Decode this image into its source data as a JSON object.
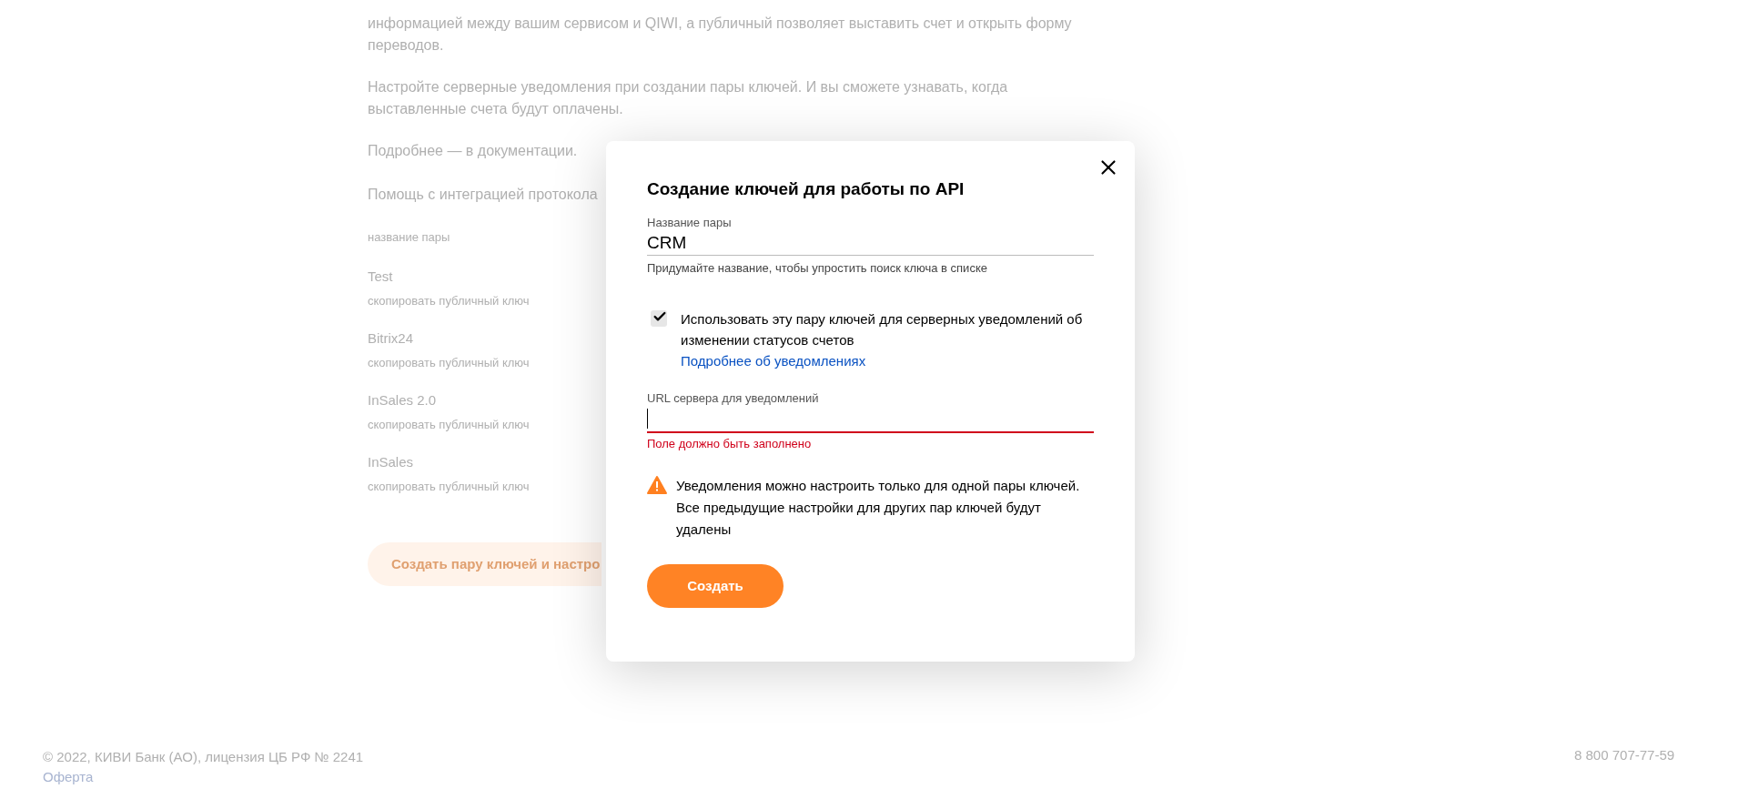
{
  "page": {
    "paragraphs": [
      "информацией между вашим сервисом и QIWI, а публичный позволяет выставить счет и открыть форму переводов.",
      "Настройте серверные уведомления при создании пары ключей. И вы сможете узнавать, когда выставленные счета будут оплачены."
    ],
    "docs_link": "Подробнее — в документации.",
    "help_link": "Помощь с интеграцией протокола",
    "list_header": "название пары",
    "keys": [
      {
        "name": "Test",
        "action": "скопировать публичный ключ"
      },
      {
        "name": "Bitrix24",
        "action": "скопировать публичный ключ"
      },
      {
        "name": "InSales 2.0",
        "action": "скопировать публичный ключ"
      },
      {
        "name": "InSales",
        "action": "скопировать публичный ключ"
      }
    ],
    "create_button": "Создать пару ключей и настро"
  },
  "footer": {
    "copyright": "© 2022, КИВИ Банк (АО), лицензия ЦБ РФ № 2241",
    "offer_link": "Оферта",
    "phone": "8 800 707-77-59"
  },
  "dialog": {
    "title": "Создание ключей для работы по API",
    "name_field": {
      "label": "Название пары",
      "value": "CRM",
      "hint": "Придумайте название, чтобы упростить поиск ключа в списке"
    },
    "notify_checkbox": {
      "checked": true,
      "label": "Использовать эту пару ключей для серверных уведомлений об изменении статусов счетов",
      "link": "Подробнее об уведомлениях"
    },
    "url_field": {
      "label": "URL сервера для уведомлений",
      "invalid": true,
      "error": "Поле должно быть заполнено"
    },
    "warning": "Уведомления можно настроить только для одной пары ключей. Все предыдущие настройки для других пар ключей будут удалены",
    "submit_button": "Создать"
  }
}
